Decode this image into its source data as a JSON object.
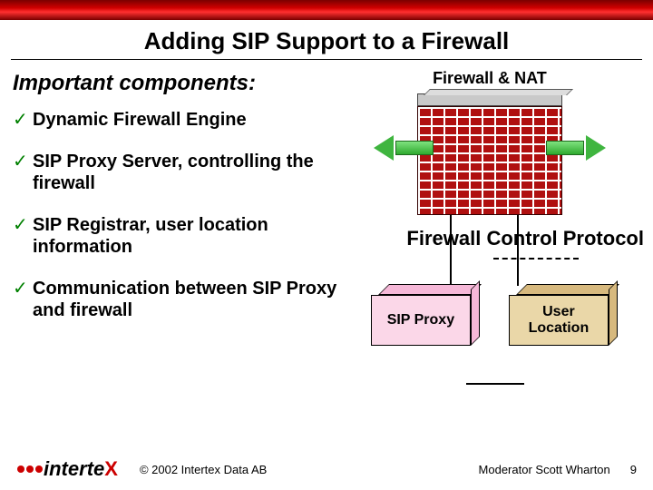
{
  "title": "Adding SIP Support to a Firewall",
  "section": "Important components:",
  "bullets": [
    "Dynamic Firewall Engine",
    "SIP Proxy Server, controlling the firewall",
    "SIP Registrar, user location information",
    "Communication between SIP Proxy and firewall"
  ],
  "diagram": {
    "firewall_label": "Firewall & NAT",
    "control_protocol": "Firewall Control Protocol",
    "box_sip_proxy": "SIP Proxy",
    "box_user_location": "User Location"
  },
  "footer": {
    "brand_inter": "inter",
    "brand_te": "te",
    "brand_x": "X",
    "copyright": "© 2002 Intertex Data AB",
    "moderator": "Moderator Scott Wharton",
    "page": "9"
  }
}
